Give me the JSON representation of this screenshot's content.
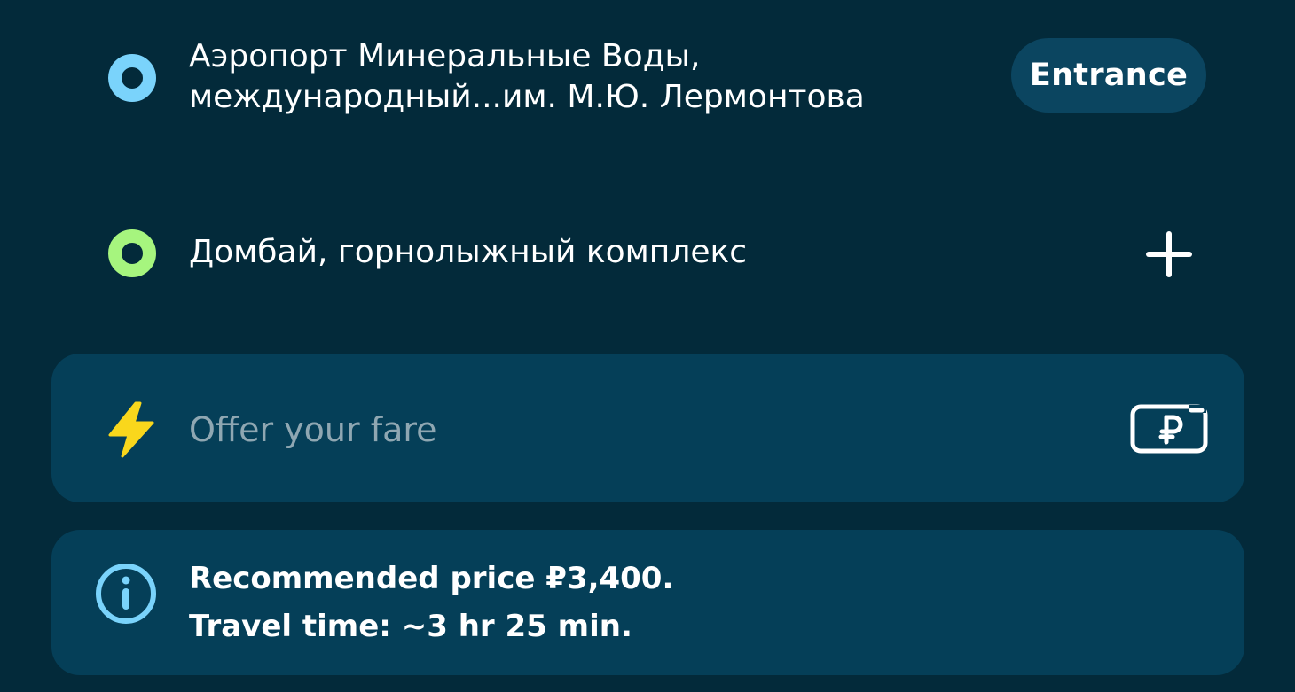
{
  "route": {
    "pickup": {
      "line1": "Аэропорт Минеральные Воды,",
      "line2": "международный...им. М.Ю. Лермонтова",
      "entrance_label": "Entrance",
      "dot_color": "#7ad3fb"
    },
    "destination": {
      "address": "Домбай, горнолыжный комплекс",
      "dot_color": "#a6f57e",
      "add_stop_icon": "plus-icon"
    }
  },
  "fare": {
    "placeholder": "Offer your fare",
    "value": "",
    "left_icon": "lightning-icon",
    "right_icon": "ruble-payment-icon"
  },
  "info": {
    "icon": "info-icon",
    "line1": "Recommended price ₽3,400.",
    "line2": "Travel time: ~3 hr 25 min."
  },
  "colors": {
    "background": "#032a3a",
    "card": "#053f58",
    "accent_yellow": "#f9d71c",
    "info_blue": "#7ad3fb"
  }
}
